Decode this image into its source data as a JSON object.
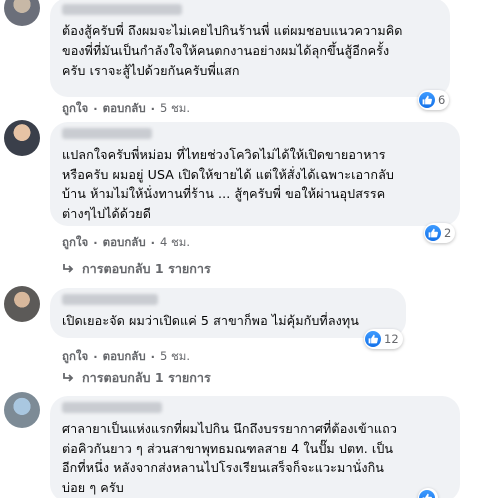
{
  "comments": [
    {
      "text": "ต้องสู้ครับพี่ ถึงผมจะไม่เคยไปกินร้านพี่ แต่ผมชอบแนวความคิด\nของพี่ที่มันเป็นกำลังใจให้คนตกงานอย่างผมได้ลุกขึ้นสู้อีกครั้ง\nครับ เราจะสู้ไปด้วยกันครับพี่แสก",
      "like_label": "ถูกใจ",
      "reply_label": "ตอบกลับ",
      "time": "5 ชม.",
      "reaction_count": "6"
    },
    {
      "text": "แปลกใจครับพี่หม่อม ที่ไทยช่วงโควิดไม่ได้ให้เปิดขายอาหาร\nหรือครับ ผมอยู่ USA เปิดให้ขายได้ แต่ให้สั่งได้เฉพาะเอากลับ\nบ้าน ห้ามไม่ให้นั่งทานที่ร้าน ... สู้ๆครับพี่ ขอให้ผ่านอุปสรรค\nต่างๆไปได้ด้วยดี",
      "like_label": "ถูกใจ",
      "reply_label": "ตอบกลับ",
      "time": "4 ชม.",
      "reaction_count": "2",
      "replies_label": "การตอบกลับ 1 รายการ"
    },
    {
      "text": "เปิดเยอะจัด ผมว่าเปิดแค่ 5 สาขาก็พอ ไม่คุ้มกับที่ลงทุน",
      "like_label": "ถูกใจ",
      "reply_label": "ตอบกลับ",
      "time": "5 ชม.",
      "reaction_count": "12",
      "replies_label": "การตอบกลับ 1 รายการ"
    },
    {
      "text": "ศาลายาเป็นแห่งแรกที่ผมไปกิน นึกถึงบรรยากาศที่ต้องเข้าแถว\nต่อคิวกันยาว ๆ ส่วนสาขาพุทธมณฑลสาย 4 ในปั๊ม ปตท. เป็น\nอีกที่หนึ่ง หลังจากส่งหลานไปโรงเรียนเสร็จก็จะแวะมานั่งกิน\nบ่อย ๆ ครับ"
    }
  ],
  "colors": {
    "bubble": "#f0f2f5",
    "meta": "#65676b",
    "like_blue": "#1877f2"
  }
}
